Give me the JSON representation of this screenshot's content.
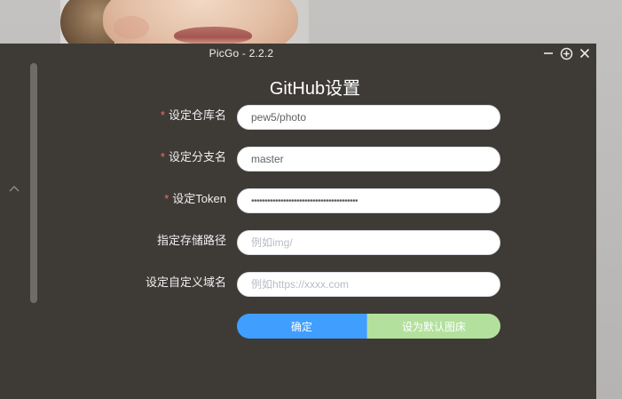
{
  "window": {
    "title": "PicGo - 2.2.2"
  },
  "icons": {
    "minimize": "minimize-icon",
    "maximize": "plus-circle-icon",
    "close": "close-icon",
    "collapse": "chevron-up-icon"
  },
  "form": {
    "title": "GitHub设置",
    "fields": [
      {
        "label": "设定仓库名",
        "required": true,
        "value": "pew5/photo",
        "placeholder": ""
      },
      {
        "label": "设定分支名",
        "required": true,
        "value": "master",
        "placeholder": ""
      },
      {
        "label": "设定Token",
        "required": true,
        "value": "••••••••••••••••••••••••••••••••••••••••",
        "placeholder": ""
      },
      {
        "label": "指定存储路径",
        "required": false,
        "value": "",
        "placeholder": "例如img/"
      },
      {
        "label": "设定自定义域名",
        "required": false,
        "value": "",
        "placeholder": "例如https://xxxx.com"
      }
    ],
    "buttons": {
      "confirm": "确定",
      "set_default": "设为默认图床"
    }
  },
  "colors": {
    "window_bg": "#3e3b37",
    "required_mark": "#f56c6c",
    "primary": "#409eff",
    "success_light": "#b3e19d"
  }
}
